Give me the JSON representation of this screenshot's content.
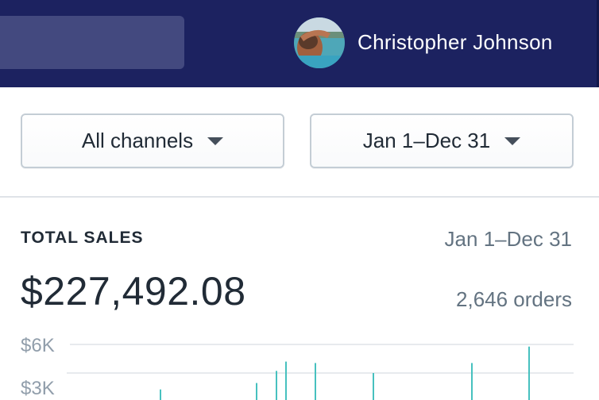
{
  "header": {
    "user_name": "Christopher Johnson",
    "avatar_icon": "user-avatar-photo",
    "background_color": "#1c2260"
  },
  "filters": {
    "channel": {
      "label": "All channels",
      "icon": "caret-down-icon"
    },
    "date": {
      "label": "Jan 1–Dec 31",
      "icon": "caret-down-icon"
    }
  },
  "total_sales": {
    "title": "TOTAL SALES",
    "date_range": "Jan 1–Dec 31",
    "amount": "$227,492.08",
    "orders": "2,646 orders"
  },
  "chart_data": {
    "type": "bar",
    "y_tick_labels": [
      "$6K",
      "$3K"
    ],
    "ylim": [
      0,
      6000
    ],
    "grid": true,
    "bar_color": "#47c1bf",
    "values": [
      2850,
      3300,
      4150,
      4800,
      4700,
      4000,
      4700,
      5850
    ]
  }
}
